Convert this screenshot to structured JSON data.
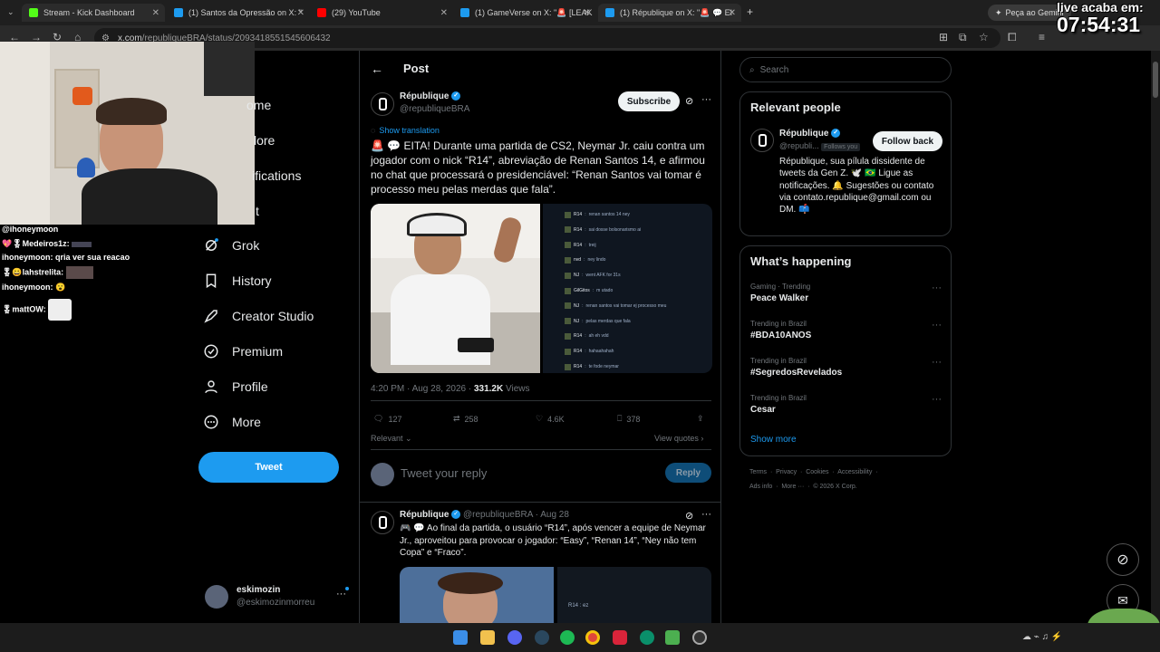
{
  "browser": {
    "tabs": [
      {
        "label": "Stream - Kick Dashboard",
        "color": "#53fc18"
      },
      {
        "label": "(1) Santos da Opressão on X: \"",
        "color": "#1d9bf0"
      },
      {
        "label": "(29) YouTube",
        "color": "#ff0000"
      },
      {
        "label": "(1) GameVerse on X: \"🚨 [LEAK",
        "color": "#1d9bf0"
      },
      {
        "label": "(1) République on X: \"🚨 💬 EI",
        "color": "#1d9bf0"
      }
    ],
    "new_tab": "+",
    "gemini_label": "Peça ao Gemini",
    "url_host": "x.com",
    "url_path": "/republiqueBRA/status/2093418551545606432"
  },
  "overlay": {
    "timer_label": "live acaba em:",
    "timer_value": "07:54:31",
    "chat": [
      {
        "user": "@ihoneymoon",
        "text": ""
      },
      {
        "user": "💖🎖Medeiros1z:",
        "text": ""
      },
      {
        "user": "ihoneymoon:",
        "text": "qria ver sua reacao"
      },
      {
        "user": "🎖😀lahstrelita:",
        "text": ""
      },
      {
        "user": "ihoneymoon:",
        "text": "😮"
      },
      {
        "user": "🎖mattOW:",
        "text": ""
      }
    ]
  },
  "nav": {
    "items": [
      {
        "label": "ome",
        "icon": "home-icon"
      },
      {
        "label": "lore",
        "icon": "explore-icon"
      },
      {
        "label": "ifications",
        "icon": "notifications-icon"
      },
      {
        "label": "t",
        "icon": "chat-icon"
      },
      {
        "label": "Grok",
        "icon": "grok-icon"
      },
      {
        "label": "History",
        "icon": "bookmark-icon"
      },
      {
        "label": "Creator Studio",
        "icon": "rocket-icon"
      },
      {
        "label": "Premium",
        "icon": "premium-icon"
      },
      {
        "label": "Profile",
        "icon": "profile-icon"
      },
      {
        "label": "More",
        "icon": "more-icon"
      }
    ],
    "tweet_button": "Tweet",
    "account_name": "eskimozin",
    "account_handle": "@eskimozinmorreu"
  },
  "post": {
    "header_title": "Post",
    "author_name": "République",
    "author_handle": "@republiqueBRA",
    "subscribe_label": "Subscribe",
    "show_translation": "Show translation",
    "text": "🚨 💬 EITA! Durante uma partida de CS2, Neymar Jr. caiu contra um jogador com o nick “R14”, abreviação de Renan Santos 14, e afirmou no chat que processará o presidenciável: “Renan Santos vai tomar é processo meu pelas merdas que fala”.",
    "chat_lines": [
      {
        "name": "R14",
        "msg": "renan santos 14 ney"
      },
      {
        "name": "R14",
        "msg": "sai dosse bolsonarismo ai"
      },
      {
        "name": "R14",
        "msg": "treij"
      },
      {
        "name": "nvd",
        "msg": "ney lindo"
      },
      {
        "name": "NJ",
        "msg": "went AFK for 31s"
      },
      {
        "name": "GilGitos",
        "msg": "m utado"
      },
      {
        "name": "NJ",
        "msg": "renan santos vai tomar ej processo meu"
      },
      {
        "name": "NJ",
        "msg": "pelas merdas que fala"
      },
      {
        "name": "R14",
        "msg": "ah eh vdd"
      },
      {
        "name": "R14",
        "msg": "hahaahahah"
      },
      {
        "name": "R14",
        "msg": "te fode neymar"
      }
    ],
    "time": "4:20 PM · Aug 28, 2026 · ",
    "views_count": "331.2K",
    "views_label": " Views",
    "replies": "127",
    "reposts": "258",
    "likes": "4.6K",
    "bookmarks": "378",
    "relevant_label": "Relevant",
    "view_quotes": "View quotes",
    "reply_placeholder": "Tweet your reply",
    "reply_button": "Reply"
  },
  "reply_post": {
    "author_name": "République",
    "meta": "@republiqueBRA · Aug 28",
    "text": "🎮 💬 Ao final da partida, o usuário “R14”, após vencer a equipe de Neymar Jr., aproveitou para provocar o jogador: “Easy”, “Renan 14”, “Ney não tem Copa” e “Fraco”.",
    "chat_line": "R14 : ez"
  },
  "sidebar": {
    "search_placeholder": "Search",
    "relevant_title": "Relevant people",
    "person_name": "République",
    "person_handle": "@republi...",
    "follows_you": "Follows you",
    "follow_back": "Follow back",
    "bio": "République, sua pílula dissidente de tweets da Gen Z. 🕊️ 🇧🇷 Ligue as notificações. 🔔 Sugestões ou contato via contato.republique@gmail.com ou DM. 📫",
    "happening_title": "What’s happening",
    "trends": [
      {
        "category": "Gaming · Trending",
        "name": "Peace Walker"
      },
      {
        "category": "Trending in Brazil",
        "name": "#BDA10ANOS"
      },
      {
        "category": "Trending in Brazil",
        "name": "#SegredosRevelados"
      },
      {
        "category": "Trending in Brazil",
        "name": "Cesar"
      }
    ],
    "show_more": "Show more",
    "footer_line1": "Terms  ·  Privacy  ·  Cookies  ·  Accessibility  ·",
    "footer_line2": "Ads info  ·  More ···  ·  © 2026 X Corp."
  },
  "colors": {
    "accent": "#1d9bf0",
    "background": "#000000",
    "border": "#2f3336"
  }
}
